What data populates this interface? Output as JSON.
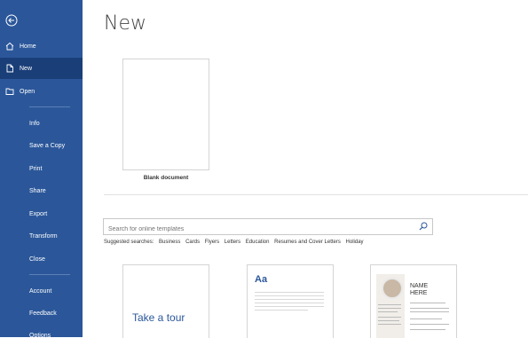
{
  "sidebar": {
    "back_icon": "back-arrow-icon",
    "items": [
      {
        "label": "Home",
        "icon": "home-icon"
      },
      {
        "label": "New",
        "icon": "new-document-icon"
      },
      {
        "label": "Open",
        "icon": "folder-icon"
      },
      {
        "label": "Info"
      },
      {
        "label": "Save a Copy"
      },
      {
        "label": "Print"
      },
      {
        "label": "Share"
      },
      {
        "label": "Export"
      },
      {
        "label": "Transform"
      },
      {
        "label": "Close"
      },
      {
        "label": "Account"
      },
      {
        "label": "Feedback"
      },
      {
        "label": "Options"
      }
    ],
    "active_item": "New"
  },
  "main": {
    "title": "New",
    "blank_document_label": "Blank document",
    "search": {
      "placeholder": "Search for online templates",
      "icon": "search-icon"
    },
    "suggested": {
      "label": "Suggested searches:",
      "items": [
        "Business",
        "Cards",
        "Flyers",
        "Letters",
        "Education",
        "Resumes and Cover Letters",
        "Holiday"
      ]
    },
    "templates": [
      {
        "text": "Take a tour"
      },
      {
        "text": "Aa"
      },
      {
        "text_line1": "NAME",
        "text_line2": "HERE"
      }
    ]
  },
  "colors": {
    "sidebar": "#2b579a",
    "sidebar_active": "#1a3f78",
    "accent": "#2b579a"
  }
}
